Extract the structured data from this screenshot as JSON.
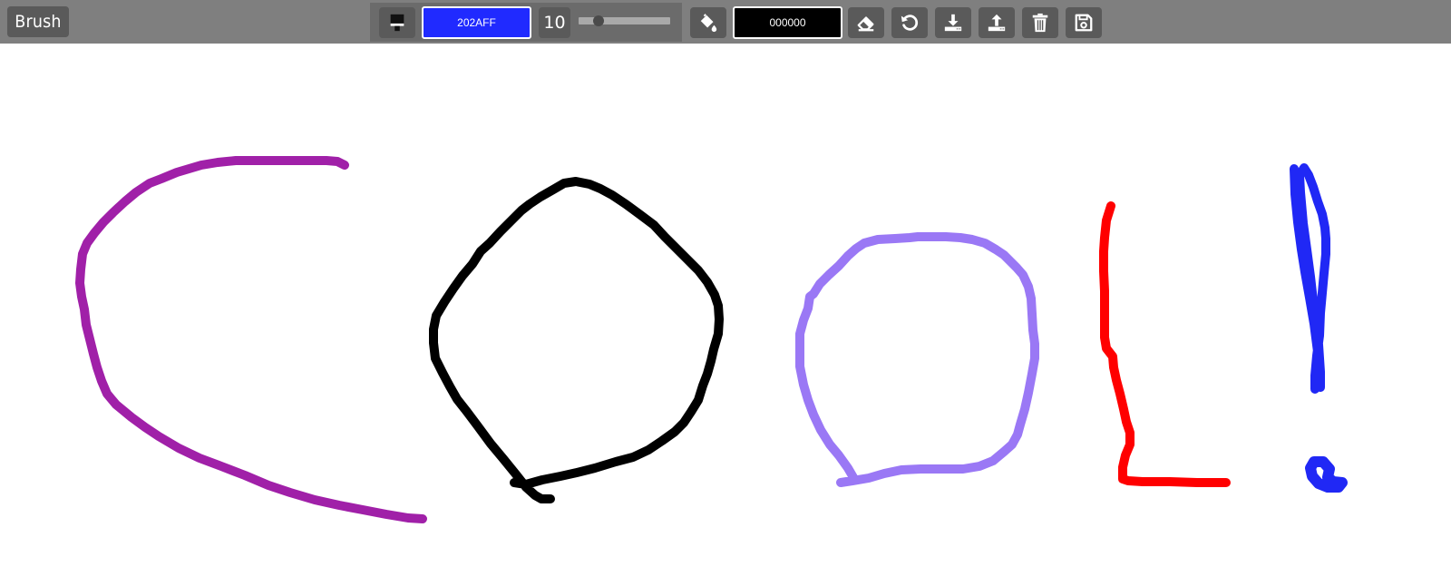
{
  "toolbar": {
    "mode_label": "Brush",
    "brush_color": "202AFF",
    "brush_size": "10",
    "brush_size_slider_value": 10,
    "fill_color": "000000",
    "icons": [
      "brush-icon",
      "paint-bucket-icon",
      "eraser-icon",
      "undo-icon",
      "download-icon",
      "upload-icon",
      "trash-icon",
      "save-icon"
    ]
  },
  "colors": {
    "toolbar_bg": "#7f7f7f",
    "button_bg": "#5a5a5a",
    "brush_swatch": "#202AFF",
    "fill_swatch": "#000000"
  },
  "canvas": {
    "strokes": [
      {
        "name": "c-stroke",
        "color": "#A020A8"
      },
      {
        "name": "o-stroke",
        "color": "#000000"
      },
      {
        "name": "o-small-stroke",
        "color": "#9A78F5"
      },
      {
        "name": "l-stroke",
        "color": "#FF0000"
      },
      {
        "name": "exclamation-stroke",
        "color": "#2028F5"
      }
    ]
  }
}
